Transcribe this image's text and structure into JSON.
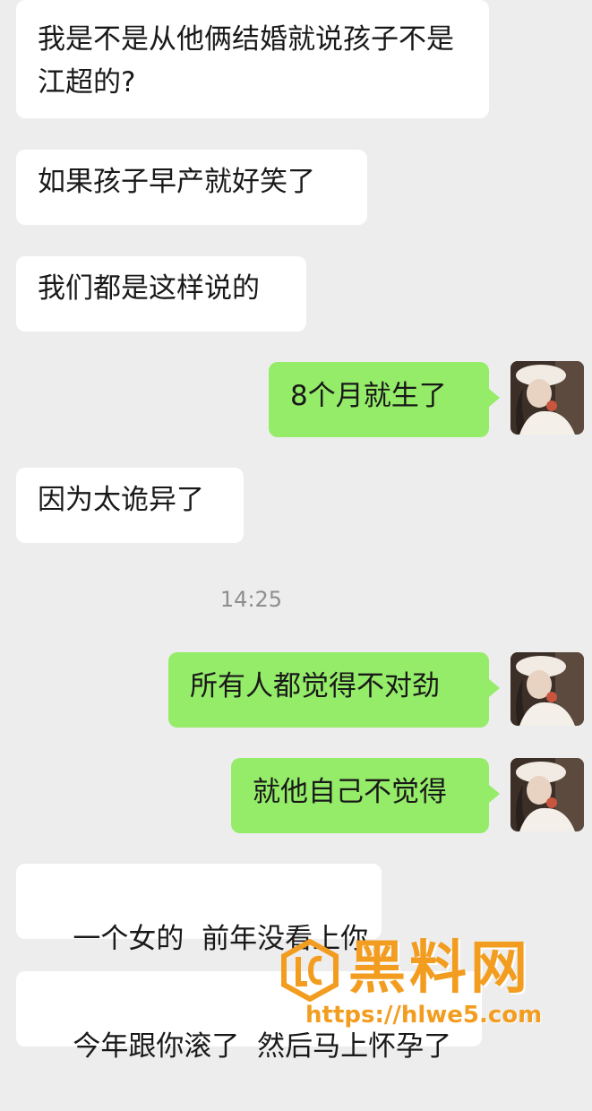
{
  "messages": [
    {
      "id": "m1",
      "side": "in",
      "text": "我是不是从他俩结婚就说孩子不是江超的?"
    },
    {
      "id": "m2",
      "side": "in",
      "text": "如果孩子早产就好笑了"
    },
    {
      "id": "m3",
      "side": "in",
      "text": "我们都是这样说的"
    },
    {
      "id": "m4",
      "side": "out",
      "text": "8个月就生了"
    },
    {
      "id": "m5",
      "side": "in",
      "text": "因为太诡异了"
    },
    {
      "id": "m6",
      "side": "out",
      "text": "所有人都觉得不对劲"
    },
    {
      "id": "m7",
      "side": "out",
      "text": "就他自己不觉得"
    },
    {
      "id": "m8",
      "side": "in",
      "text": "一个女的  前年没看上你"
    },
    {
      "id": "m9",
      "side": "in",
      "text": "今年跟你滚了  然后马上怀孕了"
    }
  ],
  "timestamp": "14:25",
  "watermark": {
    "title": "黑料网",
    "url": "https://hlwe5.com"
  },
  "colors": {
    "incoming_bubble": "#ffffff",
    "outgoing_bubble": "#95ec69",
    "background": "#ededed",
    "watermark": "#f29d1f"
  }
}
